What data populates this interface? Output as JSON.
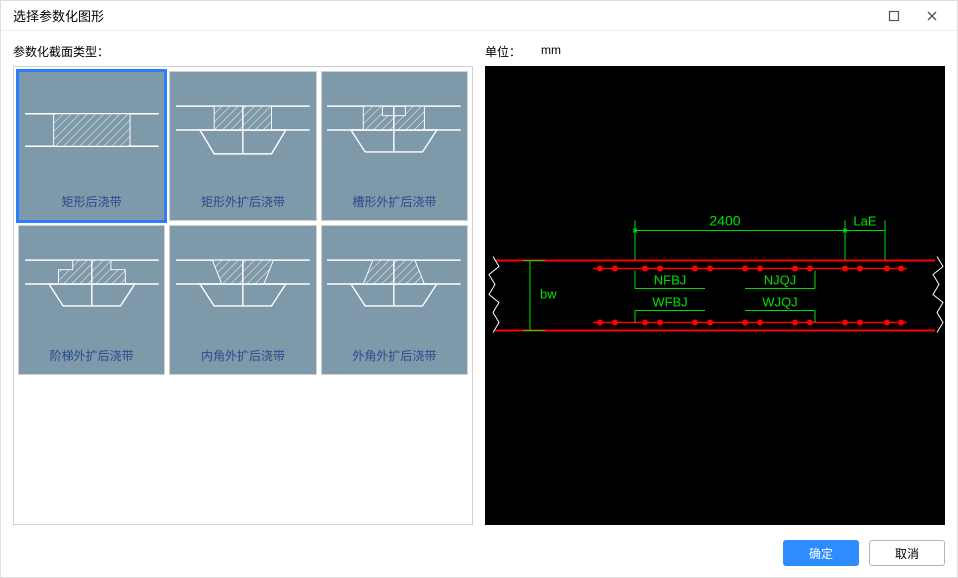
{
  "window": {
    "title": "选择参数化图形",
    "maximize_icon": "maximize",
    "close_icon": "close"
  },
  "left": {
    "label": "参数化截面类型：",
    "cards": [
      {
        "label": "矩形后浇带",
        "type": "rect",
        "selected": true
      },
      {
        "label": "矩形外扩后浇带",
        "type": "rect-exp",
        "selected": false
      },
      {
        "label": "槽形外扩后浇带",
        "type": "groove",
        "selected": false
      },
      {
        "label": "阶梯外扩后浇带",
        "type": "step",
        "selected": false
      },
      {
        "label": "内角外扩后浇带",
        "type": "inner",
        "selected": false
      },
      {
        "label": "外角外扩后浇带",
        "type": "outer",
        "selected": false
      }
    ]
  },
  "right": {
    "unit_label": "单位：",
    "unit_value": "mm"
  },
  "preview": {
    "dim_top": "2400",
    "dim_right": "LaE",
    "dim_left": "bw",
    "label_top_left": "NFBJ",
    "label_top_right": "NJQJ",
    "label_bot_left": "WFBJ",
    "label_bot_right": "WJQJ"
  },
  "footer": {
    "ok": "确定",
    "cancel": "取消"
  }
}
